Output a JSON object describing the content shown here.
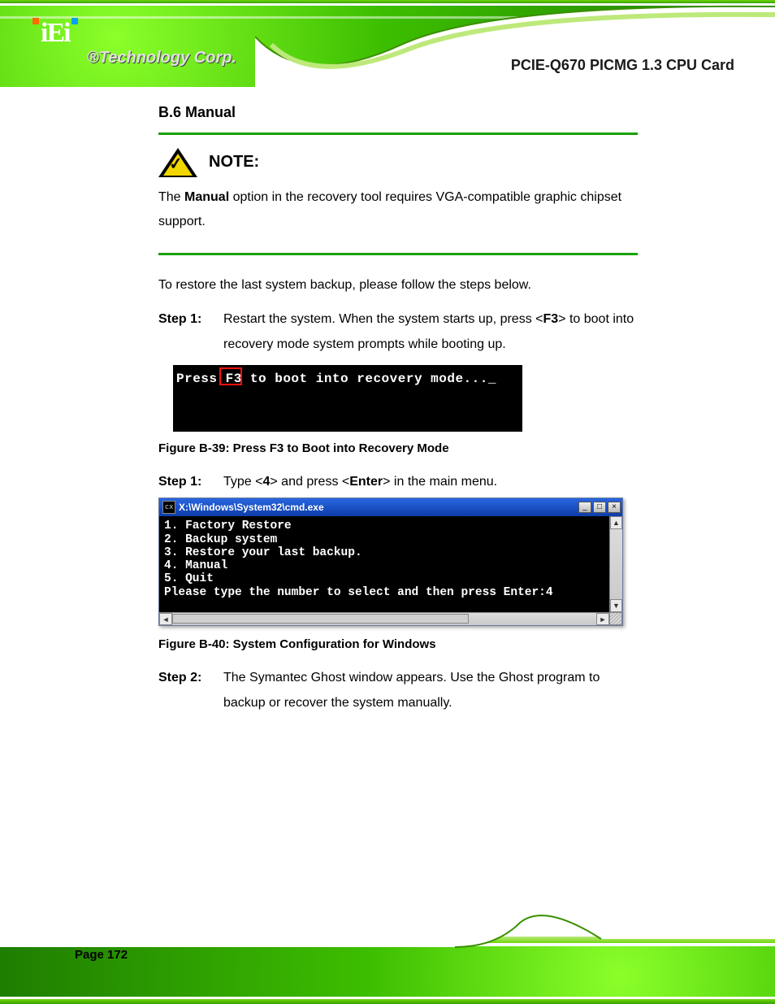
{
  "brand": {
    "logo_text": "iEi",
    "tagline": "Technology Corp.",
    "registered": "®"
  },
  "header": {
    "product_name": "PCIE-Q670 PICMG 1.3 CPU Card"
  },
  "section": {
    "number": "B.6",
    "title": "Manual"
  },
  "note": {
    "label": "NOTE:",
    "body_1": "The ",
    "body_bold": "Manual",
    "body_2": " option in the recovery tool requires VGA-compatible graphic chipset support.",
    "icon_name": "caution-check-icon"
  },
  "intro_para": "To restore the last system backup, please follow the steps below.",
  "steps": [
    {
      "label": "Step 1:",
      "pre": "Type <",
      "bold": "4",
      "post": "> and press <",
      "bold2": "Enter",
      "post2": "> in the main menu."
    },
    {
      "label": "Step 2:",
      "text_a": "The Symantec Ghost window appears. Use the Ghost program to backup or recover the system manually."
    }
  ],
  "shot1": {
    "text": "Press F3 to boot into recovery mode..._",
    "highlight_key": "F3"
  },
  "fig_cap": "Figure B-39: Press F3 to Boot into Recovery Mode",
  "step1b": {
    "label": "Step 1:",
    "text_a": "Press <",
    "bold": "F3",
    "text_b": "> to boot into recovery mode system prompts while booting up.",
    "pretext": "Restart the system. When the system starts up,"
  },
  "cmd": {
    "title": "X:\\Windows\\System32\\cmd.exe",
    "menu": [
      "1. Factory Restore",
      "2. Backup system",
      "3. Restore your last backup.",
      "4. Manual",
      "5. Quit"
    ],
    "prompt": "Please type the number to select and then press Enter:4",
    "icon_label": "cx"
  },
  "fig_cap2": "Figure B-40: System Configuration for Windows",
  "footer": {
    "page_number": "Page 172"
  }
}
